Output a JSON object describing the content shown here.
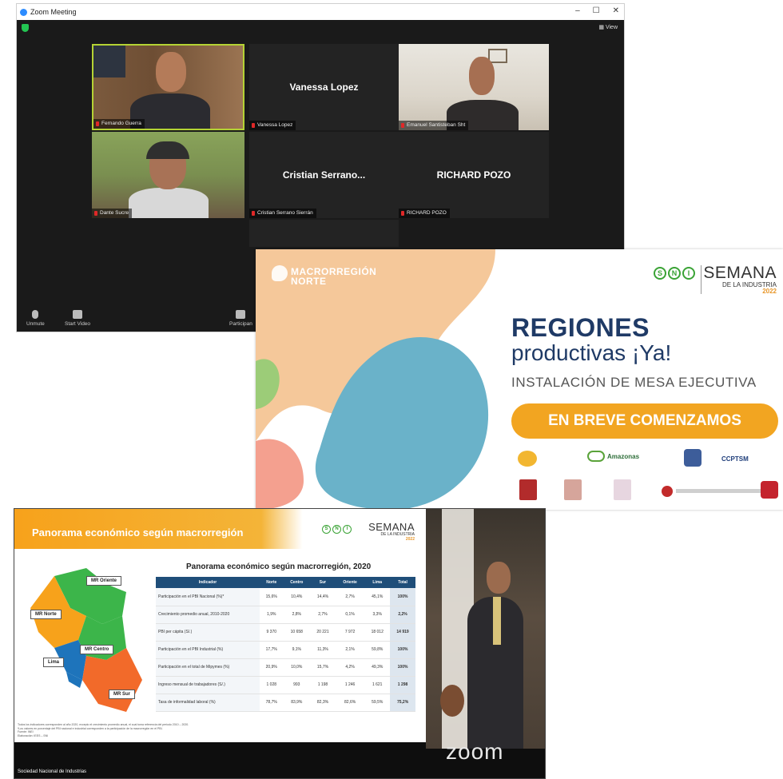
{
  "zoom_window": {
    "title": "Zoom Meeting",
    "window_controls": [
      "–",
      "☐",
      "✕"
    ],
    "view_label": "View",
    "participants": [
      {
        "name": "Fernando Guerra",
        "video": true
      },
      {
        "name": "Vanessa Lopez",
        "video": false,
        "display_name": "Vanessa Lopez"
      },
      {
        "name": "Emanuel Santisteban Sht",
        "video": true
      },
      {
        "name": "Dante Sucre",
        "video": true
      },
      {
        "name": "Cristian Serrano Sierrán",
        "video": false,
        "display_name": "Cristian Serrano..."
      },
      {
        "name": "RICHARD POZO",
        "video": false,
        "display_name": "RICHARD POZO"
      }
    ],
    "toolbar": {
      "unmute": "Unmute",
      "start_video": "Start Video",
      "participants": "Participan"
    }
  },
  "waiting_slide": {
    "brand": "MACRORREGIÓN\nNORTE",
    "sni_letters": [
      "S",
      "N",
      "I"
    ],
    "semana_line1": "SEMANA",
    "semana_line2": "DE LA INDUSTRIA",
    "semana_year": "2022",
    "title": "REGIONES",
    "subtitle": "productivas ¡Ya!",
    "line3": "INSTALACIÓN DE MESA EJECUTIVA",
    "button": "EN BREVE COMENZAMOS",
    "sponsors_row1": [
      "Amazonas",
      "CCPTSM"
    ],
    "sponsors_row2": [
      "UPAO",
      "UPN",
      "USAT"
    ]
  },
  "presentation": {
    "header_title": "Panorama económico según macrorregión",
    "semana_line1": "SEMANA",
    "semana_line2": "DE LA INDUSTRIA",
    "semana_year": "2022",
    "table_title": "Panorama económico según macrorregión, 2020",
    "map_labels": {
      "oriente": "MR Oriente",
      "norte": "MR Norte",
      "lima": "Lima",
      "centro": "MR Centro",
      "sur": "MR Sur"
    },
    "table": {
      "headers": [
        "Indicador",
        "Norte",
        "Centro",
        "Sur",
        "Oriente",
        "Lima",
        "Total"
      ],
      "rows": [
        [
          "Participación en el PBI Nacional (%)*",
          "15,6%",
          "10,4%",
          "14,4%",
          "2,7%",
          "45,1%",
          "100%"
        ],
        [
          "Crecimiento promedio anual, 2010-2020",
          "1,9%",
          "2,8%",
          "2,7%",
          "0,1%",
          "3,3%",
          "2,2%"
        ],
        [
          "PBI per cápita (S/.)",
          "9 370",
          "10 658",
          "20 221",
          "7 972",
          "18 012",
          "14 919"
        ],
        [
          "Participación en el PBI Industrial (%)",
          "17,7%",
          "9,1%",
          "11,3%",
          "2,1%",
          "59,8%",
          "100%"
        ],
        [
          "Participación en el total de Mipymes (%)",
          "20,9%",
          "10,0%",
          "15,7%",
          "4,2%",
          "49,3%",
          "100%"
        ],
        [
          "Ingreso mensual de trabajadores (S/.)",
          "1 028",
          "993",
          "1 198",
          "1 246",
          "1 621",
          "1 298"
        ],
        [
          "Tasa de informalidad laboral (%)",
          "78,7%",
          "83,9%",
          "82,3%",
          "82,6%",
          "59,5%",
          "75,2%"
        ]
      ]
    },
    "notes": [
      "Todos los indicadores corresponden al año 2020, excepto el crecimiento promedio anual, el cual toma referencia del periodo 2010 – 2020.",
      "*Los valores en porcentaje del PBI nacional e industrial corresponden a la participación de la macrorregión en el PBI.",
      "Fuente: INEI",
      "Elaboración: IEES – SNI"
    ],
    "footer": "Sociedad Nacional de Industrias",
    "zoom_brand": "zoom"
  }
}
